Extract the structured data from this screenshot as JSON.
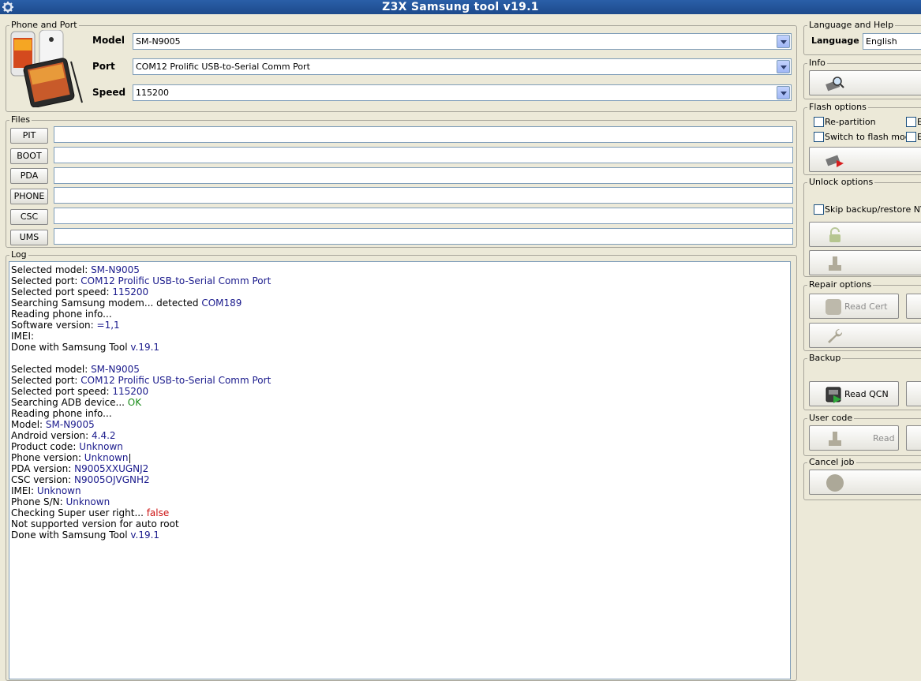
{
  "window": {
    "title": "Z3X Samsung tool v19.1"
  },
  "phone_port": {
    "group_label": "Phone and Port",
    "model_label": "Model",
    "model_value": "SM-N9005",
    "port_label": "Port",
    "port_value": "COM12 Prolific USB-to-Serial Comm Port",
    "speed_label": "Speed",
    "speed_value": "115200"
  },
  "files": {
    "group_label": "Files",
    "buttons": [
      "PIT",
      "BOOT",
      "PDA",
      "PHONE",
      "CSC",
      "UMS"
    ],
    "values": [
      "",
      "",
      "",
      "",
      "",
      ""
    ]
  },
  "log": {
    "group_label": "Log",
    "lines": [
      [
        {
          "t": "Selected model: ",
          "c": ""
        },
        {
          "t": "SM-N9005",
          "c": "blue"
        }
      ],
      [
        {
          "t": "Selected port: ",
          "c": ""
        },
        {
          "t": "COM12 Prolific USB-to-Serial Comm Port",
          "c": "blue"
        }
      ],
      [
        {
          "t": "Selected port speed: ",
          "c": ""
        },
        {
          "t": "115200",
          "c": "blue"
        }
      ],
      [
        {
          "t": "Searching Samsung modem... detected ",
          "c": ""
        },
        {
          "t": "COM189",
          "c": "blue"
        }
      ],
      [
        {
          "t": "Reading phone info...",
          "c": ""
        }
      ],
      [
        {
          "t": "Software version: ",
          "c": ""
        },
        {
          "t": "=1,1",
          "c": "blue"
        }
      ],
      [
        {
          "t": "IMEI:",
          "c": ""
        }
      ],
      [
        {
          "t": "Done with Samsung Tool ",
          "c": ""
        },
        {
          "t": "v.19.1",
          "c": "blue"
        }
      ],
      [],
      [
        {
          "t": "Selected model: ",
          "c": ""
        },
        {
          "t": "SM-N9005",
          "c": "blue"
        }
      ],
      [
        {
          "t": "Selected port: ",
          "c": ""
        },
        {
          "t": "COM12 Prolific USB-to-Serial Comm Port",
          "c": "blue"
        }
      ],
      [
        {
          "t": "Selected port speed: ",
          "c": ""
        },
        {
          "t": "115200",
          "c": "blue"
        }
      ],
      [
        {
          "t": "Searching ADB device... ",
          "c": ""
        },
        {
          "t": "OK",
          "c": "green"
        }
      ],
      [
        {
          "t": "Reading phone info...",
          "c": ""
        }
      ],
      [
        {
          "t": "Model: ",
          "c": ""
        },
        {
          "t": "SM-N9005",
          "c": "blue"
        }
      ],
      [
        {
          "t": "Android version: ",
          "c": ""
        },
        {
          "t": "4.4.2",
          "c": "blue"
        }
      ],
      [
        {
          "t": "Product code: ",
          "c": ""
        },
        {
          "t": "Unknown",
          "c": "blue"
        }
      ],
      [
        {
          "t": "Phone version: ",
          "c": ""
        },
        {
          "t": "Unknown",
          "c": "blue"
        }
      ],
      [
        {
          "t": "PDA version: ",
          "c": ""
        },
        {
          "t": "N9005XXUGNJ2",
          "c": "blue"
        }
      ],
      [
        {
          "t": "CSC version: ",
          "c": ""
        },
        {
          "t": "N9005OJVGNH2",
          "c": "blue"
        }
      ],
      [
        {
          "t": "IMEI: ",
          "c": ""
        },
        {
          "t": "Unknown",
          "c": "blue"
        }
      ],
      [
        {
          "t": "Phone S/N: ",
          "c": ""
        },
        {
          "t": "Unknown",
          "c": "blue"
        }
      ],
      [
        {
          "t": "Checking Super user right... ",
          "c": ""
        },
        {
          "t": "false",
          "c": "red"
        }
      ],
      [
        {
          "t": "Not supported version for auto root",
          "c": ""
        }
      ],
      [
        {
          "t": "Done with Samsung Tool ",
          "c": ""
        },
        {
          "t": "v.19.1",
          "c": "blue"
        }
      ]
    ]
  },
  "language_help": {
    "group_label": "Language and Help",
    "language_label": "Language",
    "language_value": "English"
  },
  "info": {
    "group_label": "Info"
  },
  "flash_options": {
    "group_label": "Flash options",
    "repartition": "Re-partition",
    "switch_flash": "Switch to flash mode",
    "extra_1": "E",
    "extra_2": "E"
  },
  "unlock_options": {
    "group_label": "Unlock options",
    "skip_backup": "Skip backup/restore NVM"
  },
  "repair_options": {
    "group_label": "Repair options",
    "read_cert": "Read Cert"
  },
  "backup": {
    "group_label": "Backup",
    "read_qcn": "Read QCN"
  },
  "user_code": {
    "group_label": "User code",
    "read": "Read"
  },
  "cancel_job": {
    "group_label": "Cancel job"
  },
  "colors": {
    "titlebar": "#2a5fa8",
    "panel": "#ece9d8",
    "log_value": "#1a1a8c",
    "log_ok": "#1a8c1a",
    "log_false": "#cc1111"
  }
}
